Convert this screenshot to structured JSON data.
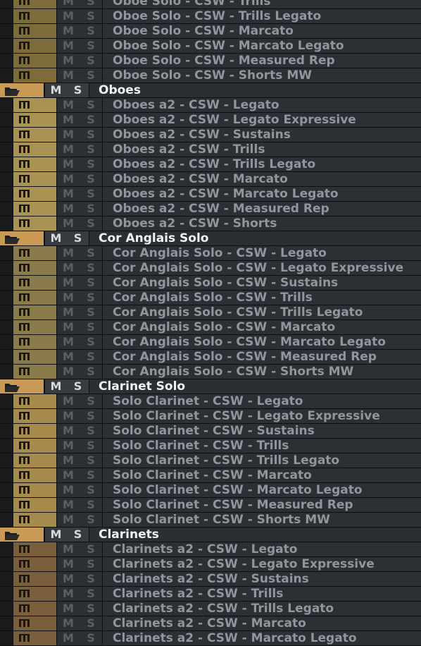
{
  "mute_label": "M",
  "solo_label": "S",
  "colors": {
    "oboe": "#7d6c3a",
    "oboes": "#a89354",
    "cor": "#8a7c4a",
    "clarinet_solo": "#a58b4e",
    "clarinets": "#7a5f3d",
    "folder": "#c99a55"
  },
  "rows": [
    {
      "type": "track",
      "name": "Oboe Solo - CSW - Trills",
      "color": "#7d6c3a"
    },
    {
      "type": "track",
      "name": "Oboe Solo - CSW - Trills Legato",
      "color": "#7d6c3a"
    },
    {
      "type": "track",
      "name": "Oboe Solo - CSW - Marcato",
      "color": "#7d6c3a"
    },
    {
      "type": "track",
      "name": "Oboe Solo - CSW - Marcato Legato",
      "color": "#7d6c3a"
    },
    {
      "type": "track",
      "name": "Oboe Solo - CSW - Measured Rep",
      "color": "#7d6c3a"
    },
    {
      "type": "track",
      "name": "Oboe Solo - CSW - Shorts MW",
      "color": "#7d6c3a"
    },
    {
      "type": "folder",
      "name": "Oboes",
      "color": "#c99a55",
      "icon": "folder-open-icon"
    },
    {
      "type": "track",
      "name": "Oboes a2 - CSW - Legato",
      "color": "#a89354"
    },
    {
      "type": "track",
      "name": "Oboes a2 - CSW - Legato Expressive",
      "color": "#a89354"
    },
    {
      "type": "track",
      "name": "Oboes a2 - CSW - Sustains",
      "color": "#a89354"
    },
    {
      "type": "track",
      "name": "Oboes a2 - CSW - Trills",
      "color": "#a89354"
    },
    {
      "type": "track",
      "name": "Oboes a2 - CSW - Trills Legato",
      "color": "#a89354"
    },
    {
      "type": "track",
      "name": "Oboes a2 - CSW - Marcato",
      "color": "#a89354"
    },
    {
      "type": "track",
      "name": "Oboes a2 - CSW - Marcato Legato",
      "color": "#a89354"
    },
    {
      "type": "track",
      "name": "Oboes a2 - CSW - Measured Rep",
      "color": "#a89354"
    },
    {
      "type": "track",
      "name": "Oboes a2 - CSW - Shorts",
      "color": "#a89354"
    },
    {
      "type": "folder",
      "name": "Cor Anglais Solo",
      "color": "#c99a55",
      "icon": "folder-open-icon"
    },
    {
      "type": "track",
      "name": "Cor Anglais Solo - CSW - Legato",
      "color": "#8a7c4a"
    },
    {
      "type": "track",
      "name": "Cor Anglais Solo - CSW - Legato Expressive",
      "color": "#8a7c4a"
    },
    {
      "type": "track",
      "name": "Cor Anglais Solo - CSW - Sustains",
      "color": "#8a7c4a"
    },
    {
      "type": "track",
      "name": "Cor Anglais Solo - CSW - Trills",
      "color": "#8a7c4a"
    },
    {
      "type": "track",
      "name": "Cor Anglais Solo - CSW - Trills Legato",
      "color": "#8a7c4a"
    },
    {
      "type": "track",
      "name": "Cor Anglais Solo - CSW - Marcato",
      "color": "#8a7c4a"
    },
    {
      "type": "track",
      "name": "Cor Anglais Solo - CSW - Marcato Legato",
      "color": "#8a7c4a"
    },
    {
      "type": "track",
      "name": "Cor Anglais Solo - CSW - Measured Rep",
      "color": "#8a7c4a"
    },
    {
      "type": "track",
      "name": "Cor Anglais Solo - CSW - Shorts MW",
      "color": "#8a7c4a"
    },
    {
      "type": "folder",
      "name": "Clarinet Solo",
      "color": "#c99a55",
      "icon": "folder-open-icon"
    },
    {
      "type": "track",
      "name": "Solo Clarinet - CSW - Legato",
      "color": "#a58b4e"
    },
    {
      "type": "track",
      "name": "Solo Clarinet - CSW - Legato Expressive",
      "color": "#a58b4e"
    },
    {
      "type": "track",
      "name": "Solo Clarinet - CSW - Sustains",
      "color": "#a58b4e"
    },
    {
      "type": "track",
      "name": "Solo Clarinet - CSW - Trills",
      "color": "#a58b4e"
    },
    {
      "type": "track",
      "name": "Solo Clarinet - CSW - Trills Legato",
      "color": "#a58b4e"
    },
    {
      "type": "track",
      "name": "Solo Clarinet - CSW - Marcato",
      "color": "#a58b4e"
    },
    {
      "type": "track",
      "name": "Solo Clarinet - CSW - Marcato Legato",
      "color": "#a58b4e"
    },
    {
      "type": "track",
      "name": "Solo Clarinet - CSW - Measured Rep",
      "color": "#a58b4e"
    },
    {
      "type": "track",
      "name": "Solo Clarinet - CSW - Shorts MW",
      "color": "#a58b4e"
    },
    {
      "type": "folder",
      "name": "Clarinets",
      "color": "#c99a55",
      "icon": "folder-open-icon"
    },
    {
      "type": "track",
      "name": "Clarinets a2 - CSW - Legato",
      "color": "#7a5f3d"
    },
    {
      "type": "track",
      "name": "Clarinets a2 - CSW - Legato Expressive",
      "color": "#7a5f3d"
    },
    {
      "type": "track",
      "name": "Clarinets a2 - CSW - Sustains",
      "color": "#7a5f3d"
    },
    {
      "type": "track",
      "name": "Clarinets a2 - CSW - Trills",
      "color": "#7a5f3d"
    },
    {
      "type": "track",
      "name": "Clarinets a2 - CSW - Trills Legato",
      "color": "#7a5f3d"
    },
    {
      "type": "track",
      "name": "Clarinets a2 - CSW - Marcato",
      "color": "#7a5f3d"
    },
    {
      "type": "track",
      "name": "Clarinets a2 - CSW - Marcato Legato",
      "color": "#7a5f3d"
    }
  ]
}
